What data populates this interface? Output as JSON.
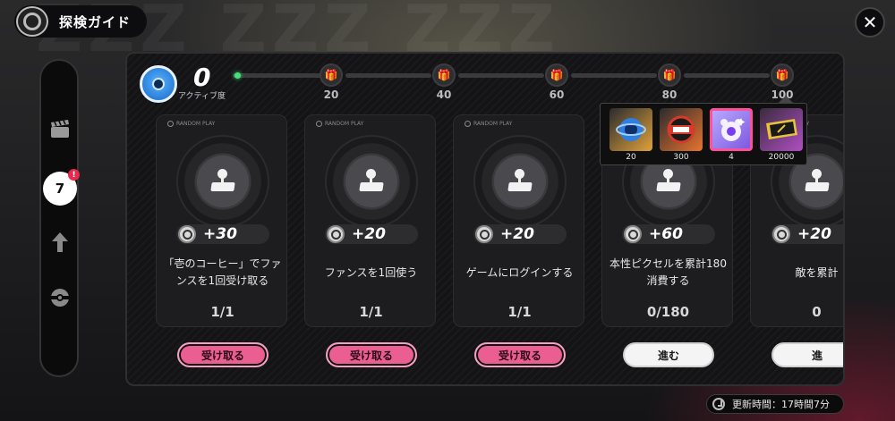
{
  "header": {
    "title": "探検ガイド",
    "close_glyph": "✕"
  },
  "sidebar": {
    "items": [
      {
        "icon": "clapper-icon",
        "active": false
      },
      {
        "icon": "guide-7-icon",
        "active": true,
        "glyph": "7",
        "badge": "!"
      },
      {
        "icon": "up-arrow-icon",
        "active": false
      },
      {
        "icon": "disc-icon",
        "active": false
      }
    ]
  },
  "activity": {
    "value": "0",
    "label": "アクティブ度",
    "milestones": [
      "20",
      "40",
      "60",
      "80",
      "100"
    ]
  },
  "rewards_popup": {
    "items": [
      {
        "icon": "blue-orb-icon",
        "qty": "20",
        "color": "#e0a23a"
      },
      {
        "icon": "ticket-badge-icon",
        "qty": "300",
        "color": "#e8742e"
      },
      {
        "icon": "star-bear-icon",
        "qty": "4",
        "color": "#9a6ae6"
      },
      {
        "icon": "gold-ticket-icon",
        "qty": "20000",
        "color": "#b04fc4"
      }
    ]
  },
  "tasks": [
    {
      "points": "+30",
      "text": "「壱のコーヒー」でファンスを1回受け取る",
      "progress": "1/1",
      "button": "受け取る",
      "state": "claim"
    },
    {
      "points": "+20",
      "text": "ファンスを1回使う",
      "progress": "1/1",
      "button": "受け取る",
      "state": "claim"
    },
    {
      "points": "+20",
      "text": "ゲームにログインする",
      "progress": "1/1",
      "button": "受け取る",
      "state": "claim"
    },
    {
      "points": "+60",
      "text": "本性ピクセルを累計180消費する",
      "progress": "0/180",
      "button": "進む",
      "state": "go"
    },
    {
      "points": "+20",
      "text": "敵を累計",
      "progress": "0",
      "button": "進",
      "state": "go"
    }
  ],
  "footer": {
    "refresh_text": "更新時間：17時間7分"
  }
}
